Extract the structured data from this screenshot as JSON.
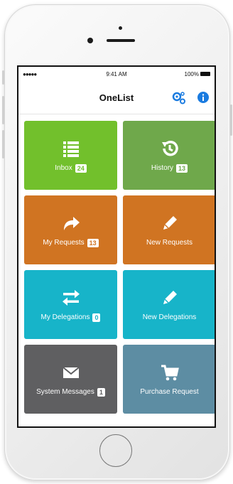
{
  "status_bar": {
    "signal": "●●●●● ",
    "time": "9:41 AM",
    "battery": "100%"
  },
  "nav": {
    "title": "OneList",
    "settings_icon": "gear-icon",
    "info_icon": "info-icon"
  },
  "tiles": [
    {
      "label": "Inbox",
      "badge": "24",
      "icon": "list-icon",
      "color": "#72c02c"
    },
    {
      "label": "History",
      "badge": "13",
      "icon": "history-icon",
      "color": "#6fa84b"
    },
    {
      "label": "My Requests",
      "badge": "13",
      "icon": "share-arrow-icon",
      "color": "#d07422"
    },
    {
      "label": "New Requests",
      "badge": "",
      "icon": "pencil-icon",
      "color": "#d07422"
    },
    {
      "label": "My Delegations",
      "badge": "0",
      "icon": "exchange-arrows-icon",
      "color": "#17b4c9"
    },
    {
      "label": "New Delegations",
      "badge": "",
      "icon": "pencil-icon",
      "color": "#17b4c9"
    },
    {
      "label": "System Messages",
      "badge": "1",
      "icon": "envelope-icon",
      "color": "#5f5f61"
    },
    {
      "label": "Purchase Request",
      "badge": "",
      "icon": "shopping-cart-icon",
      "color": "#5d8da3"
    }
  ],
  "colors": {
    "accent_blue": "#1a7be0"
  }
}
